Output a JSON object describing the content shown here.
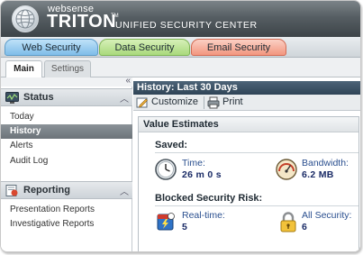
{
  "brand": {
    "small": "websense",
    "big": "TRITON",
    "subtitle": "UNIFIED SECURITY CENTER"
  },
  "product_tabs": [
    {
      "label": "Web Security"
    },
    {
      "label": "Data Security"
    },
    {
      "label": "Email Security"
    }
  ],
  "sub_tabs": [
    {
      "label": "Main"
    },
    {
      "label": "Settings"
    }
  ],
  "sidebar": {
    "collapse_icon": "double-chevron-left-icon",
    "sections": [
      {
        "title": "Status",
        "icon": "status-monitor-icon",
        "items": [
          {
            "label": "Today"
          },
          {
            "label": "History",
            "active": true
          },
          {
            "label": "Alerts"
          },
          {
            "label": "Audit Log"
          }
        ]
      },
      {
        "title": "Reporting",
        "icon": "reporting-icon",
        "items": [
          {
            "label": "Presentation Reports"
          },
          {
            "label": "Investigative Reports"
          }
        ]
      }
    ]
  },
  "content": {
    "title": "History: Last 30 Days",
    "toolbar": {
      "customize_label": "Customize",
      "print_label": "Print"
    },
    "panel": {
      "title": "Value Estimates",
      "saved": {
        "label": "Saved:",
        "time_label": "Time:",
        "time_value": "26 m 0 s",
        "bandwidth_label": "Bandwidth:",
        "bandwidth_value": "6.2 MB"
      },
      "blocked": {
        "label": "Blocked Security Risk:",
        "realtime_label": "Real-time:",
        "realtime_value": "5",
        "allsecurity_label": "All Security:",
        "allsecurity_value": "6"
      }
    }
  },
  "colors": {
    "header_dark": "#3d4448",
    "title_bar": "#2f4456",
    "value_blue": "#1a2b66",
    "active_nav": "#6c7379"
  }
}
